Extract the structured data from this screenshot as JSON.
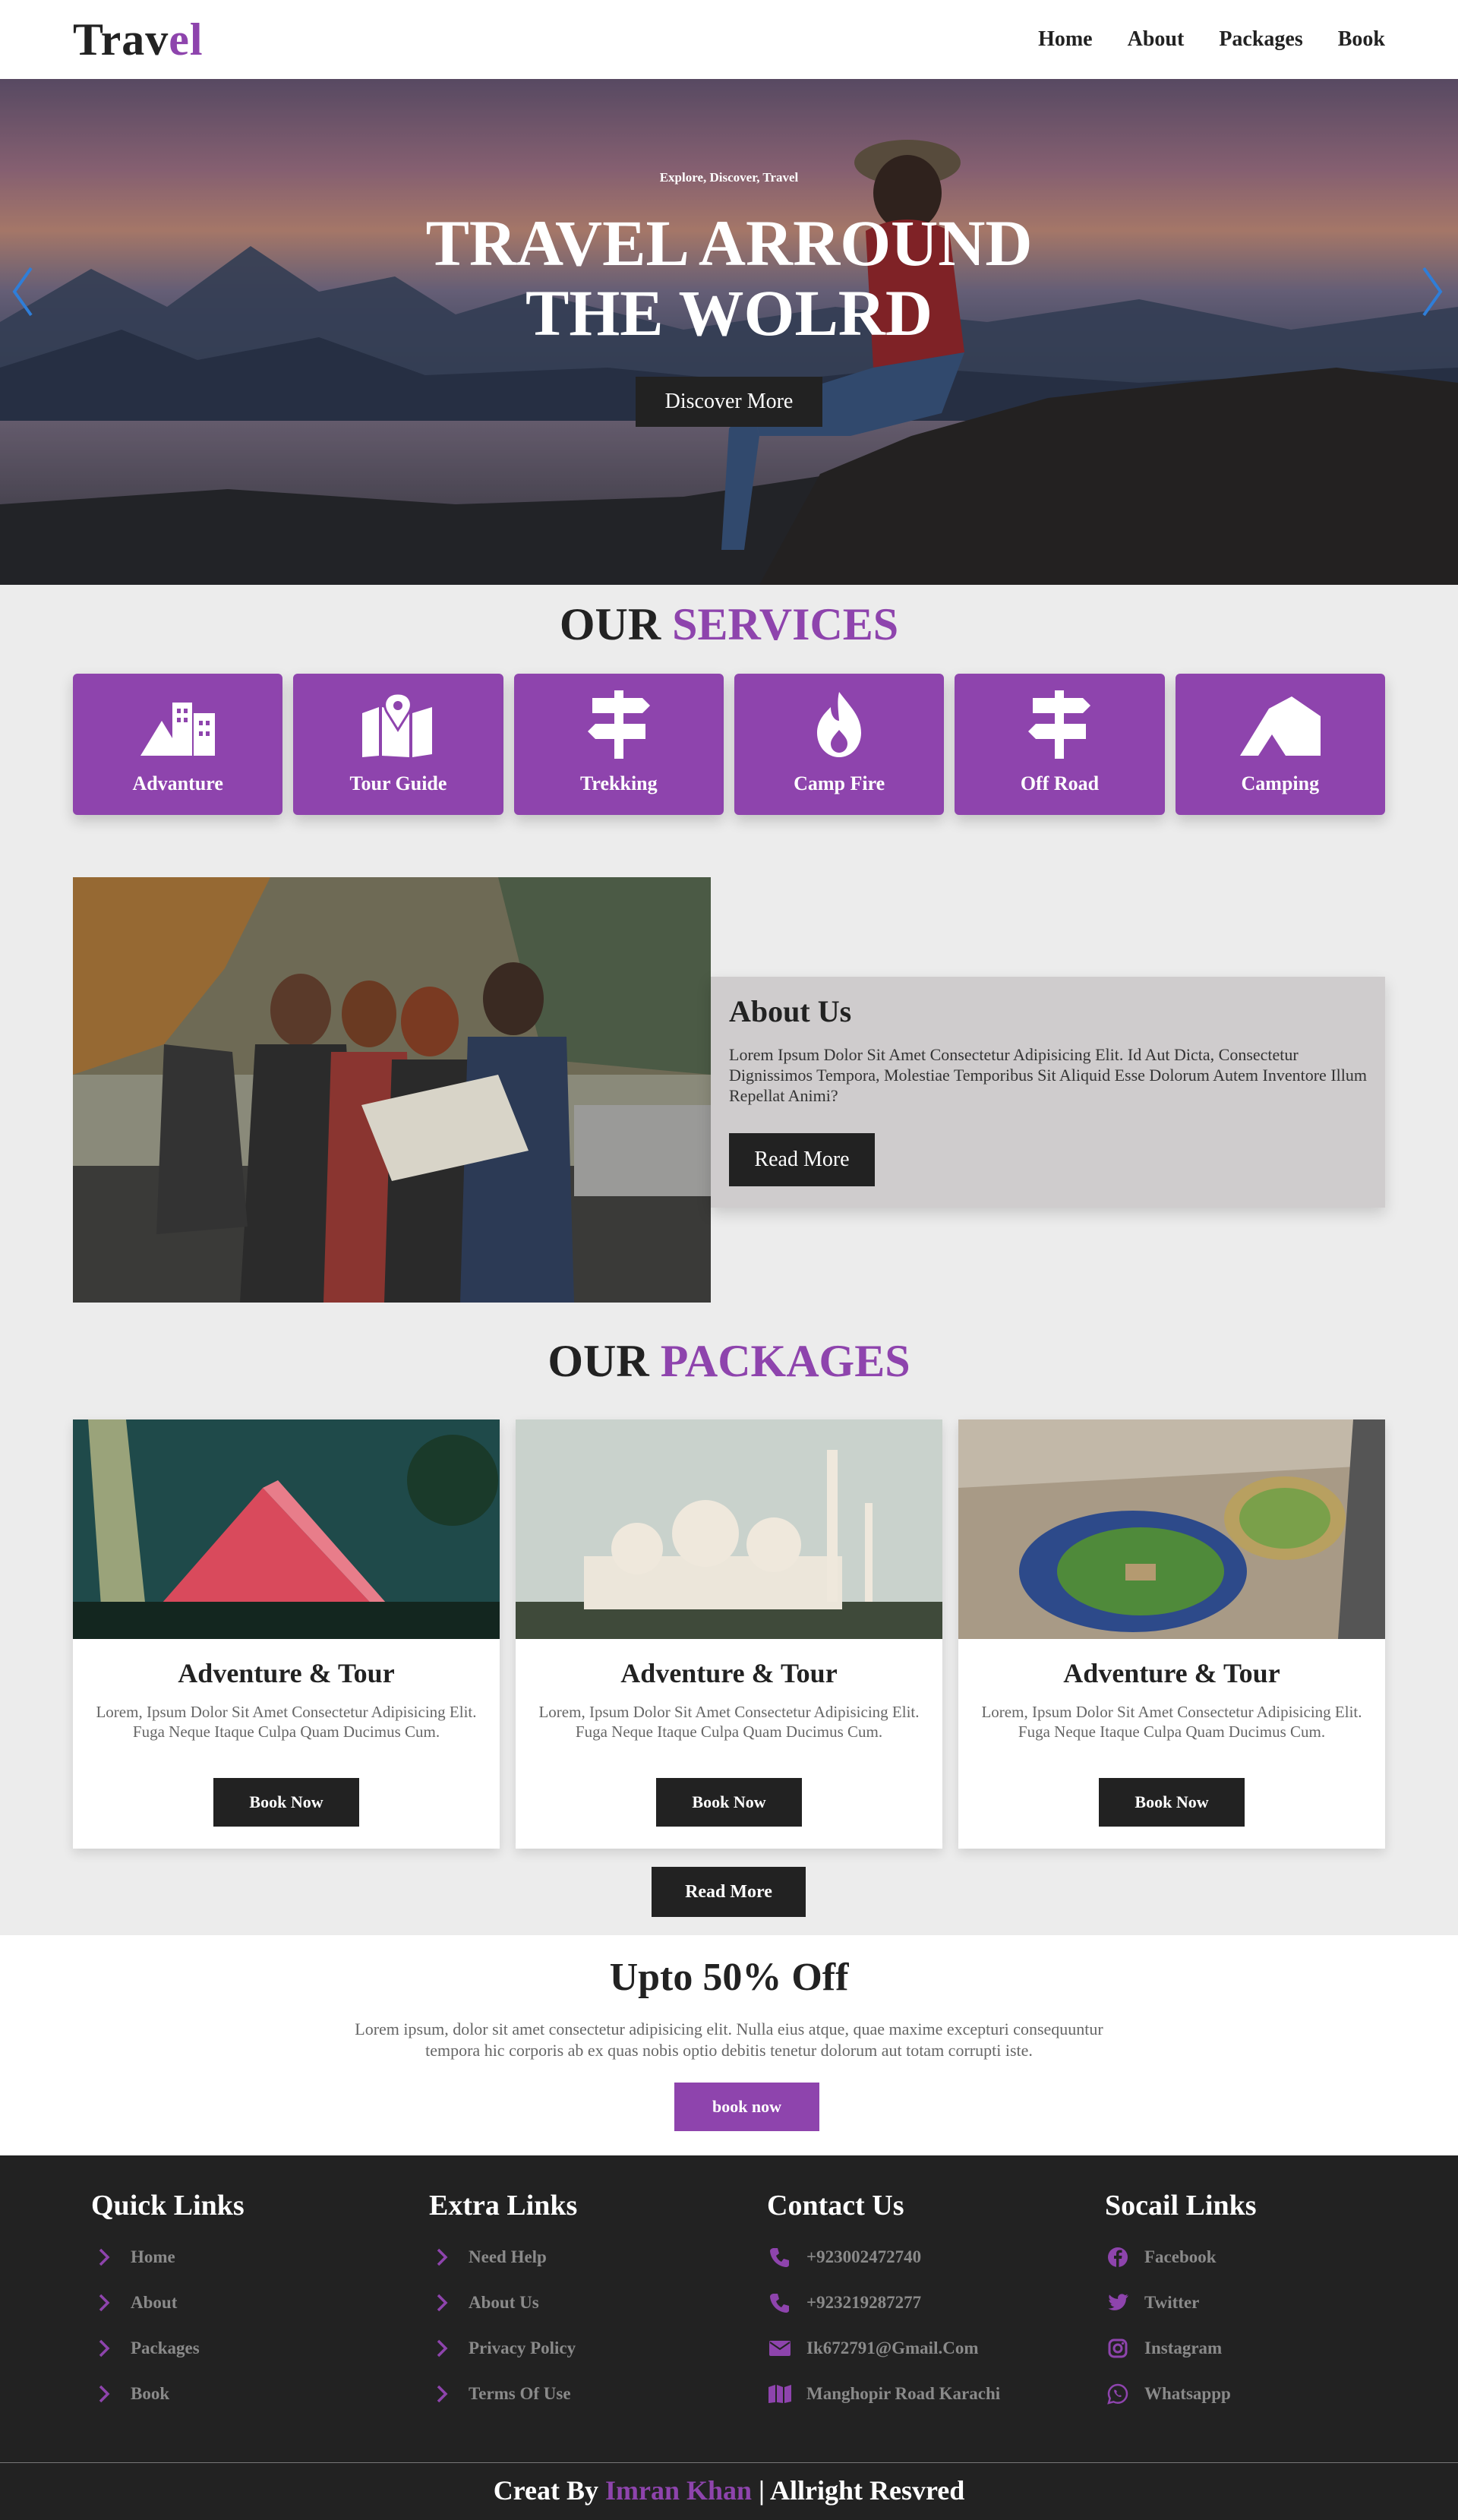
{
  "colors": {
    "accent": "#8e44ad",
    "dark": "#222222",
    "light_bg": "#ececec"
  },
  "header": {
    "logo_part1": "Trav",
    "logo_part2": "el",
    "nav": [
      "Home",
      "About",
      "Packages",
      "Book"
    ]
  },
  "hero": {
    "subtitle": "Explore, Discover, Travel",
    "title_line1": "TRAVEL ARROUND",
    "title_line2": "THE WOLRD",
    "button": "Discover More",
    "prev_icon": "chevron-left-icon",
    "next_icon": "chevron-right-icon"
  },
  "services": {
    "title_part1": "OUR",
    "title_part2": "SERVICES",
    "items": [
      {
        "label": "Advanture",
        "icon": "city-icon"
      },
      {
        "label": "Tour Guide",
        "icon": "map-location-icon"
      },
      {
        "label": "Trekking",
        "icon": "signpost-icon"
      },
      {
        "label": "Camp Fire",
        "icon": "fire-icon"
      },
      {
        "label": "Off Road",
        "icon": "signpost-icon"
      },
      {
        "label": "Camping",
        "icon": "tent-icon"
      }
    ]
  },
  "about": {
    "title": "About Us",
    "text": "Lorem Ipsum Dolor Sit Amet Consectetur Adipisicing Elit. Id Aut Dicta, Consectetur Dignissimos Tempora, Molestiae Temporibus Sit Aliquid Esse Dolorum Autem Inventore Illum Repellat Animi?",
    "button": "Read More"
  },
  "packages": {
    "title_part1": "OUR",
    "title_part2": "PACKAGES",
    "items": [
      {
        "title": "Adventure & Tour",
        "text": "Lorem, Ipsum Dolor Sit Amet Consectetur Adipisicing Elit. Fuga Neque Itaque Culpa Quam Ducimus Cum.",
        "button": "Book Now"
      },
      {
        "title": "Adventure & Tour",
        "text": "Lorem, Ipsum Dolor Sit Amet Consectetur Adipisicing Elit. Fuga Neque Itaque Culpa Quam Ducimus Cum.",
        "button": "Book Now"
      },
      {
        "title": "Adventure & Tour",
        "text": "Lorem, Ipsum Dolor Sit Amet Consectetur Adipisicing Elit. Fuga Neque Itaque Culpa Quam Ducimus Cum.",
        "button": "Book Now"
      }
    ],
    "read_more": "Read More"
  },
  "offer": {
    "title": "Upto 50% Off",
    "text": "Lorem ipsum, dolor sit amet consectetur adipisicing elit. Nulla eius atque, quae maxime excepturi consequuntur tempora hic corporis ab ex quas nobis optio debitis tenetur dolorum aut totam corrupti iste.",
    "button": "book now"
  },
  "footer": {
    "quick_links": {
      "title": "Quick Links",
      "items": [
        "Home",
        "About",
        "Packages",
        "Book"
      ]
    },
    "extra_links": {
      "title": "Extra Links",
      "items": [
        "Need Help",
        "About Us",
        "Privacy Policy",
        "Terms Of Use"
      ]
    },
    "contact": {
      "title": "Contact Us",
      "items": [
        {
          "text": "+923002472740",
          "icon": "phone-icon"
        },
        {
          "text": "+923219287277",
          "icon": "phone-icon"
        },
        {
          "text": "Ik672791@Gmail.Com",
          "icon": "envelope-icon"
        },
        {
          "text": "Manghopir Road Karachi",
          "icon": "map-icon"
        }
      ]
    },
    "social": {
      "title": "Socail Links",
      "items": [
        {
          "text": "Facebook",
          "icon": "facebook-icon"
        },
        {
          "text": "Twitter",
          "icon": "twitter-icon"
        },
        {
          "text": "Instagram",
          "icon": "instagram-icon"
        },
        {
          "text": "Whatsappp",
          "icon": "whatsapp-icon"
        }
      ]
    },
    "credit_prefix": "Creat By",
    "credit_name": "Imran Khan",
    "credit_suffix": "| Allright Resvred"
  }
}
